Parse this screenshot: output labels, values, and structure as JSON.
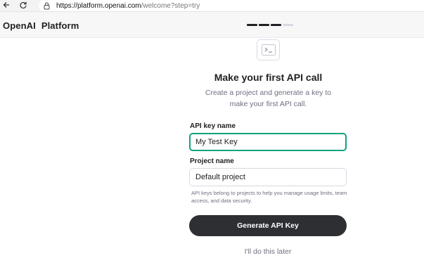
{
  "browser": {
    "url_host": "https://platform.openai.com",
    "url_path": "/welcome?step=try"
  },
  "header": {
    "brand_left": "OpenAI",
    "brand_right": "Platform",
    "progress": {
      "total_steps": 4,
      "completed_steps": 3
    }
  },
  "main": {
    "icon": "terminal-icon",
    "title": "Make your first API call",
    "subtitle": "Create a project and generate a key to make your first API call.",
    "api_key_label": "API key name",
    "api_key_value": "My Test Key",
    "project_label": "Project name",
    "project_value": "Default project",
    "help_text": "API keys belong to projects to help you manage usage limits, team access, and data security.",
    "generate_button": "Generate API Key",
    "later_link": "I'll do this later"
  },
  "colors": {
    "accent": "#10a37f",
    "button_bg": "#2e2f33",
    "muted_text": "#6e6e80"
  }
}
